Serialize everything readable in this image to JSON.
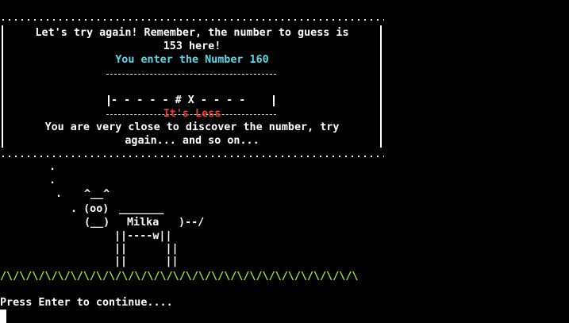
{
  "message_box": {
    "line1": "Let's try again! Remember, the number to guess is",
    "line2": "153 here!",
    "entered": "You enter the Number 160",
    "rule_top": "------------------------",
    "track": "- - - - - # X - - - -",
    "rule_bottom": "------------------------",
    "result": "It's Less",
    "hint1": "You are very close to discover the number, try",
    "hint2": "again... and so on..."
  },
  "cow_art": {
    "dot1": ".",
    "dot2": ".",
    "dot3": ".",
    "ears": "^__^",
    "head": ". (oo)",
    "back": "_______",
    "nose": "(__)",
    "sign": "Milka",
    "tail": ")--/",
    "legs_top": "||----w||",
    "legs_mid": "||      ||",
    "legs_bottom": "||      ||"
  },
  "grass": "/\\/\\/\\/\\/\\/\\/\\/\\/\\/\\/\\/\\/\\/\\/\\/\\/\\/\\/\\/\\/\\/\\/\\/\\/\\/\\/\\/\\",
  "prompt": "Press Enter to continue....",
  "colors": {
    "background": "#000000",
    "text": "#ffffff",
    "entered": "#58d9e8",
    "result": "#e33b2e",
    "grass": "#a4e630"
  }
}
